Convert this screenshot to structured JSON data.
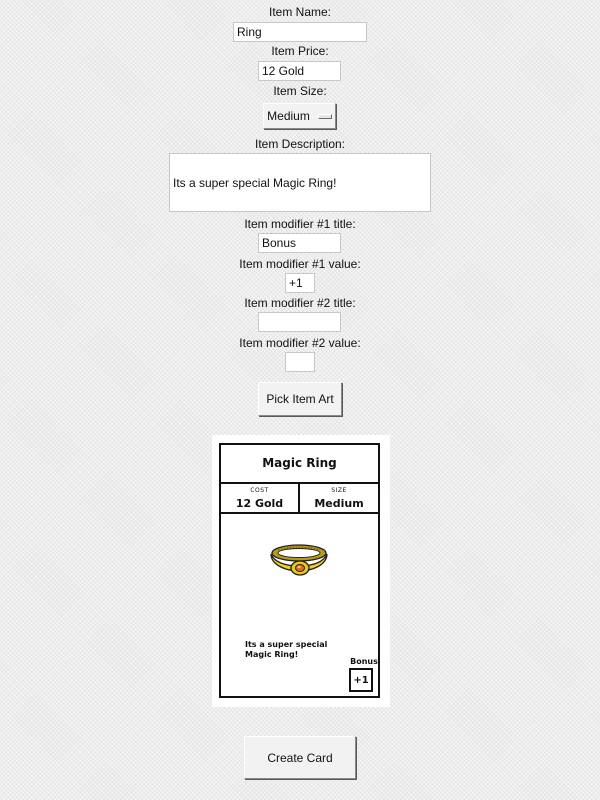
{
  "form": {
    "name_label": "Item Name:",
    "name_value": "Ring",
    "price_label": "Item Price:",
    "price_value": "12 Gold",
    "size_label": "Item Size:",
    "size_value": "Medium",
    "description_label": "Item Description:",
    "description_value": "Its a super special Magic Ring!",
    "mod1_title_label": "Item modifier #1 title:",
    "mod1_title_value": "Bonus",
    "mod1_value_label": "Item modifier #1 value:",
    "mod1_value_value": "+1",
    "mod2_title_label": "Item modifier #2 title:",
    "mod2_title_value": "",
    "mod2_value_label": "Item modifier #2 value:",
    "mod2_value_value": "",
    "pick_art_label": "Pick Item Art",
    "create_card_label": "Create Card"
  },
  "card": {
    "title": "Magic Ring",
    "cost_caption": "COST",
    "cost_value": "12 Gold",
    "size_caption": "SIZE",
    "size_value": "Medium",
    "art": "gold-ring-icon",
    "description": "Its a super special Magic Ring!",
    "modifier_title": "Bonus",
    "modifier_value": "+1"
  }
}
